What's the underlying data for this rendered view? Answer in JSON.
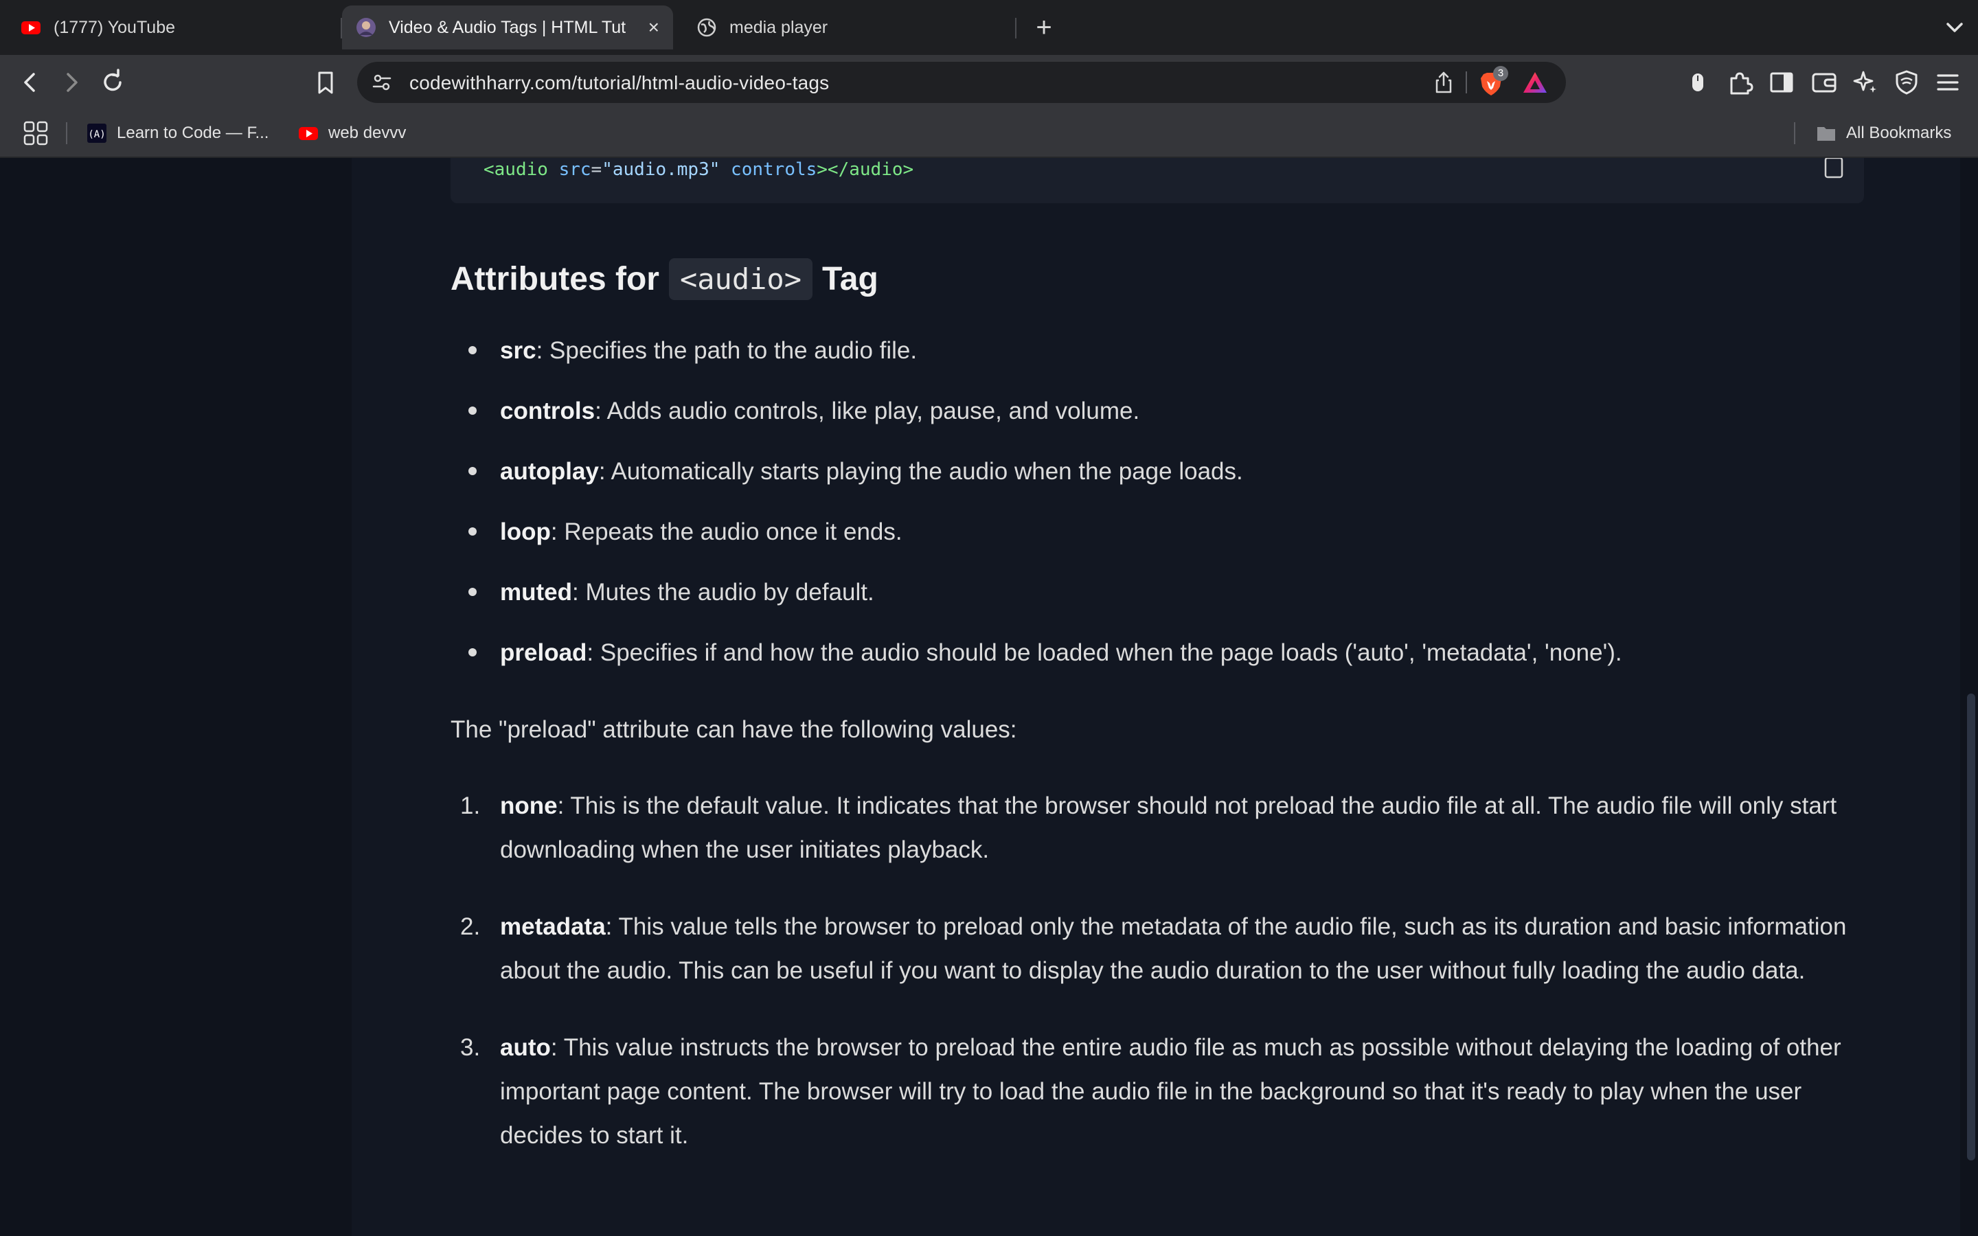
{
  "browser": {
    "tabs": [
      {
        "title": "(1777) YouTube",
        "icon": "youtube-icon",
        "active": false
      },
      {
        "title": "Video & Audio Tags | HTML Tut",
        "icon": "avatar-icon",
        "active": true
      },
      {
        "title": "media player",
        "icon": "globe-icon",
        "active": false
      }
    ],
    "new_tab_label": "+",
    "close_label": "×",
    "url": "codewithharry.com/tutorial/html-audio-video-tags",
    "brave_badge": "3",
    "bookmarks": [
      {
        "label": "Learn to Code — F...",
        "icon": "freecodecamp-icon"
      },
      {
        "label": "web devvv",
        "icon": "youtube-icon"
      }
    ],
    "all_bookmarks_label": "All Bookmarks",
    "accent_color": "#fb542b"
  },
  "content": {
    "code": {
      "open_tag": "<audio",
      "attr1": "src",
      "eq": "=",
      "val1": "\"audio.mp3\"",
      "attr2": "controls",
      "close": "></audio>"
    },
    "heading": {
      "prefix": "Attributes for",
      "code": "<audio>",
      "suffix": "Tag"
    },
    "attributes": [
      {
        "name": "src",
        "desc": ": Specifies the path to the audio file."
      },
      {
        "name": "controls",
        "desc": ": Adds audio controls, like play, pause, and volume."
      },
      {
        "name": "autoplay",
        "desc": ": Automatically starts playing the audio when the page loads."
      },
      {
        "name": "loop",
        "desc": ": Repeats the audio once it ends."
      },
      {
        "name": "muted",
        "desc": ": Mutes the audio by default."
      },
      {
        "name": "preload",
        "desc": ": Specifies if and how the audio should be loaded when the page loads ('auto', 'metadata', 'none')."
      }
    ],
    "preload_intro": "The \"preload\" attribute can have the following values:",
    "preload_values": [
      {
        "num": "1.",
        "name": "none",
        "desc": ": This is the default value. It indicates that the browser should not preload the audio file at all. The audio file will only start downloading when the user initiates playback."
      },
      {
        "num": "2.",
        "name": "metadata",
        "desc": ": This value tells the browser to preload only the metadata of the audio file, such as its duration and basic information about the audio. This can be useful if you want to display the audio duration to the user without fully loading the audio data."
      },
      {
        "num": "3.",
        "name": "auto",
        "desc": ": This value instructs the browser to preload the entire audio file as much as possible without delaying the loading of other important page content. The browser will try to load the audio file in the background so that it's ready to play when the user decides to start it."
      }
    ]
  }
}
